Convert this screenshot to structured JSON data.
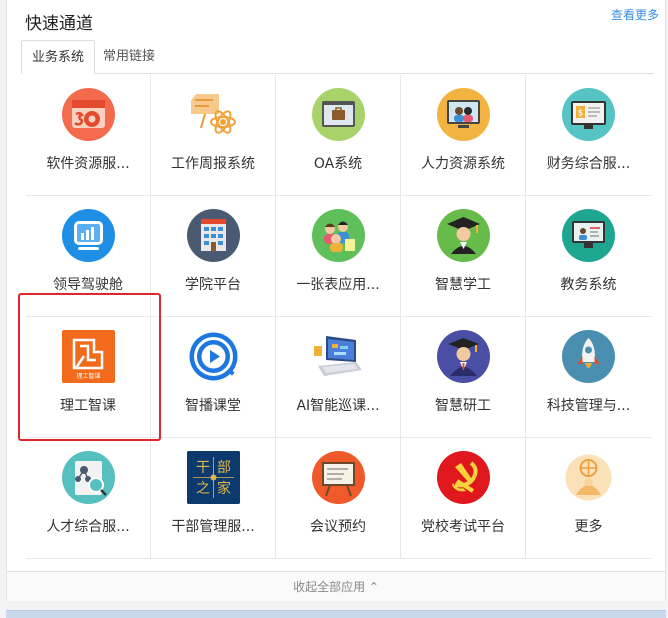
{
  "header": {
    "title": "快速通道",
    "more": "查看更多"
  },
  "tabs": [
    "业务系统",
    "常用链接"
  ],
  "rows": [
    [
      {
        "label": "软件资源服...",
        "icon": "software-icon"
      },
      {
        "label": "工作周报系统",
        "icon": "weekly-report-icon"
      },
      {
        "label": "OA系统",
        "icon": "oa-briefcase-icon"
      },
      {
        "label": "人力资源系统",
        "icon": "hr-people-icon"
      },
      {
        "label": "财务综合服...",
        "icon": "finance-icon"
      }
    ],
    [
      {
        "label": "领导驾驶舱",
        "icon": "dashboard-icon"
      },
      {
        "label": "学院平台",
        "icon": "building-icon"
      },
      {
        "label": "一张表应用...",
        "icon": "people-table-icon"
      },
      {
        "label": "智慧学工",
        "icon": "graduate-icon"
      },
      {
        "label": "教务系统",
        "icon": "classroom-icon"
      }
    ],
    [
      {
        "label": "理工智课",
        "icon": "smart-course-icon",
        "logo_text": "理工智课"
      },
      {
        "label": "智播课堂",
        "icon": "play-icon"
      },
      {
        "label": "AI智能巡课...",
        "icon": "laptop-ai-icon"
      },
      {
        "label": "智慧研工",
        "icon": "researcher-icon"
      },
      {
        "label": "科技管理与...",
        "icon": "rocket-icon"
      }
    ],
    [
      {
        "label": "人才综合服...",
        "icon": "talent-icon"
      },
      {
        "label": "干部管理服...",
        "icon": "cadre-icon",
        "logo_text": [
          "干",
          "部",
          "之",
          "家"
        ]
      },
      {
        "label": "会议预约",
        "icon": "meeting-board-icon"
      },
      {
        "label": "党校考试平台",
        "icon": "party-emblem-icon"
      },
      {
        "label": "更多",
        "icon": "more-basketball-icon"
      }
    ]
  ],
  "footer": {
    "collapse": "收起全部应用 ⌃"
  },
  "colors": {
    "accent": "#3a8ee6",
    "highlight": "#e0252b"
  }
}
